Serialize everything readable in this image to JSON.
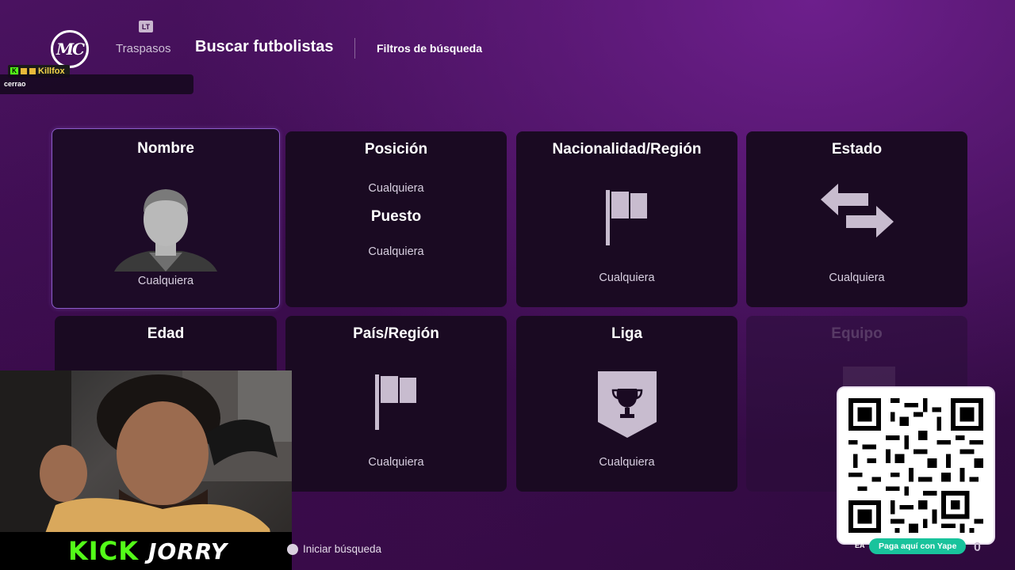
{
  "header": {
    "logo_text": "MC",
    "lt_badge": "LT",
    "tab_transfers": "Traspasos",
    "tab_search": "Buscar futbolistas",
    "tab_filters": "Filtros de búsqueda"
  },
  "chat": {
    "username": "Killfox",
    "message": "cerrao"
  },
  "cards": {
    "name": {
      "title": "Nombre",
      "value": "Cualquiera"
    },
    "position": {
      "title": "Posición",
      "value": "Cualquiera",
      "sub_title": "Puesto",
      "sub_value": "Cualquiera"
    },
    "nationality": {
      "title": "Nacionalidad/Región",
      "value": "Cualquiera"
    },
    "status": {
      "title": "Estado",
      "value": "Cualquiera"
    },
    "age": {
      "title": "Edad"
    },
    "country": {
      "title": "País/Región",
      "value": "Cualquiera"
    },
    "league": {
      "title": "Liga",
      "value": "Cualquiera"
    },
    "team": {
      "title": "Equipo"
    }
  },
  "footer": {
    "start_search": "Iniciar búsqueda",
    "ea_label": "EA",
    "corner_number": "0"
  },
  "stream": {
    "platform": "KICK",
    "streamer": "JORRY",
    "qr_pill": "Paga aquí con Yape"
  },
  "colors": {
    "accent_selected": "#8a5cc8",
    "kick_green": "#53fc18",
    "yape_teal": "#19c39c",
    "card_bg": "#1a0a22"
  }
}
